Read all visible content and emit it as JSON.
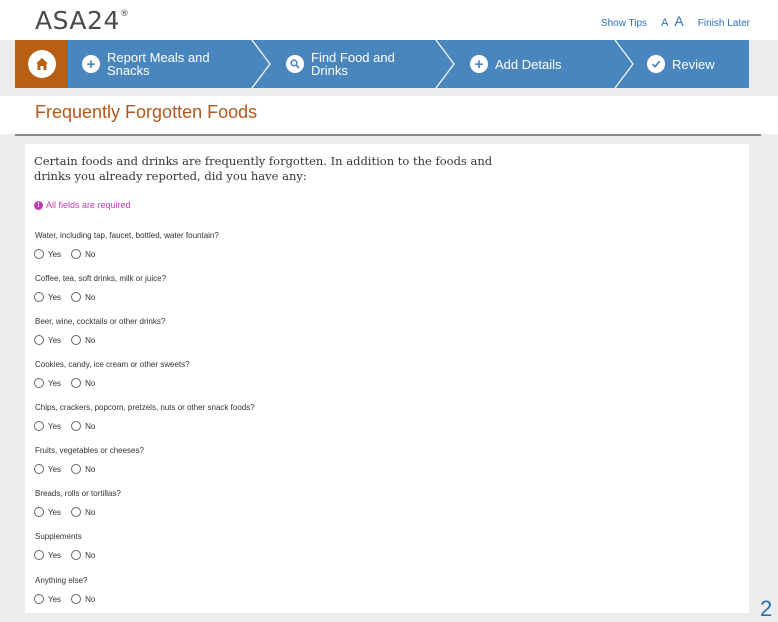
{
  "header": {
    "logo_text": "ASA24",
    "logo_mark": "®",
    "links": {
      "show_tips": "Show Tips",
      "text_small": "A",
      "text_large": "A",
      "finish_later": "Finish Later"
    }
  },
  "nav": {
    "home_icon": "home-icon",
    "steps": [
      {
        "line1": "Report Meals and",
        "line2": "Snacks",
        "icon": "plus-icon"
      },
      {
        "line1": "Find Food and",
        "line2": "Drinks",
        "icon": "search-icon"
      },
      {
        "line1": "Add Details",
        "line2": "",
        "icon": "plus-icon"
      },
      {
        "line1": "Review",
        "line2": "",
        "icon": "check-icon"
      }
    ]
  },
  "page": {
    "title": "Frequently Forgotten Foods",
    "intro_line1": "Certain foods and drinks are frequently forgotten. In addition to the foods and",
    "intro_line2": "drinks you already reported, did you have any:",
    "required_note": "All fields are required"
  },
  "questions": [
    {
      "text": "Water, including tap, faucet, bottled, water fountain?",
      "yes": "Yes",
      "no": "No"
    },
    {
      "text": "Coffee, tea, soft drinks, milk or juice?",
      "yes": "Yes",
      "no": "No"
    },
    {
      "text": "Beer, wine, cocktails or other drinks?",
      "yes": "Yes",
      "no": "No"
    },
    {
      "text": "Cookies, candy, ice cream or other sweets?",
      "yes": "Yes",
      "no": "No"
    },
    {
      "text": "Chips, crackers, popcorn, pretzels, nuts or other snack foods?",
      "yes": "Yes",
      "no": "No"
    },
    {
      "text": "Fruits, vegetables or cheeses?",
      "yes": "Yes",
      "no": "No"
    },
    {
      "text": "Breads, rolls or tortillas?",
      "yes": "Yes",
      "no": "No"
    },
    {
      "text": "Supplements",
      "yes": "Yes",
      "no": "No"
    },
    {
      "text": "Anything else?",
      "yes": "Yes",
      "no": "No"
    }
  ],
  "corner_text": "2",
  "colors": {
    "nav_blue": "#4a86be",
    "home_orange": "#b95f13",
    "title_orange": "#b0581e",
    "required_magenta": "#c13bb0",
    "link_blue": "#2a72b5"
  }
}
